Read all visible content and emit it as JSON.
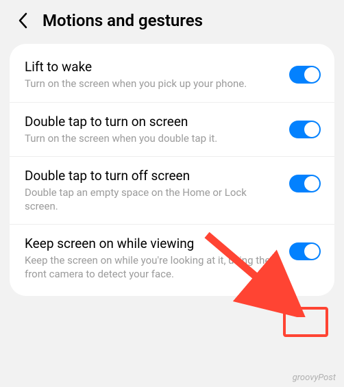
{
  "header": {
    "title": "Motions and gestures"
  },
  "settings": [
    {
      "title": "Lift to wake",
      "description": "Turn on the screen when you pick up your phone.",
      "enabled": true
    },
    {
      "title": "Double tap to turn on screen",
      "description": "Turn on the screen when you double tap it.",
      "enabled": true
    },
    {
      "title": "Double tap to turn off screen",
      "description": "Double tap an empty space on the Home or Lock screen.",
      "enabled": true
    },
    {
      "title": "Keep screen on while viewing",
      "description": "Keep the screen on while you're looking at it, using the front camera to detect your face.",
      "enabled": true
    }
  ],
  "watermark": "groovyPost",
  "annotation": {
    "highlight_target": "keep-screen-on-toggle",
    "color": "#ff4433"
  }
}
